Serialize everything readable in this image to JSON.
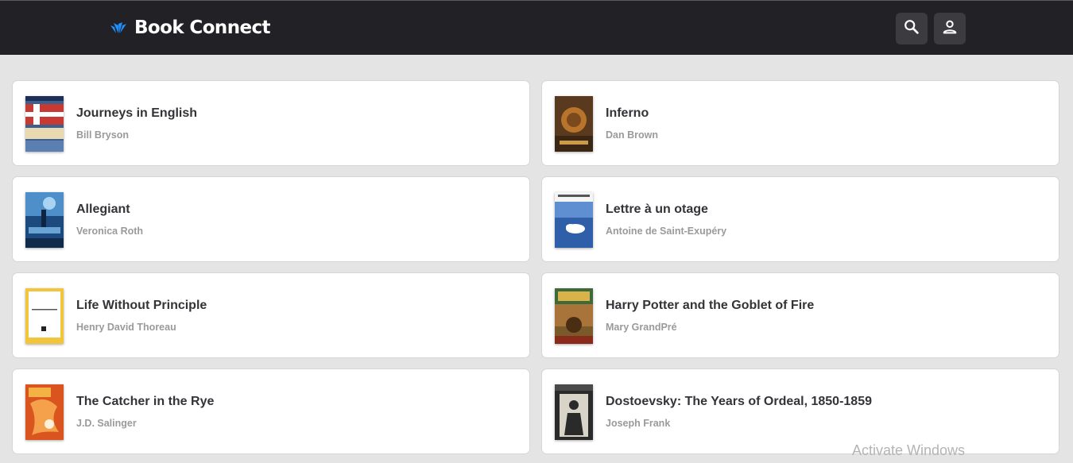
{
  "header": {
    "brand_name": "Book Connect",
    "brand_icon": "book-connect-logo-icon",
    "search_icon": "search-icon",
    "account_icon": "account-icon"
  },
  "books": [
    {
      "title": "Journeys in English",
      "author": "Bill Bryson",
      "cover_color": "#3b5f8f"
    },
    {
      "title": "Inferno",
      "author": "Dan Brown",
      "cover_color": "#5a3a1e"
    },
    {
      "title": "Allegiant",
      "author": "Veronica Roth",
      "cover_color": "#1c4a7e"
    },
    {
      "title": "Lettre à un otage",
      "author": "Antoine de Saint-Exupéry",
      "cover_color": "#2f5fa8"
    },
    {
      "title": "Life Without Principle",
      "author": "Henry David Thoreau",
      "cover_color": "#f2c53d"
    },
    {
      "title": "Harry Potter and the Goblet of Fire",
      "author": "Mary GrandPré",
      "cover_color": "#7a5a2a"
    },
    {
      "title": "The Catcher in the Rye",
      "author": "J.D. Salinger",
      "cover_color": "#d9541e"
    },
    {
      "title": "Dostoevsky: The Years of Ordeal, 1850-1859",
      "author": "Joseph Frank",
      "cover_color": "#2a2a2a"
    }
  ],
  "watermark": "Activate Windows",
  "colors": {
    "header_bg": "#222226",
    "page_bg": "#e4e4e4",
    "card_bg": "#ffffff",
    "brand_accent": "#1e90ff"
  }
}
